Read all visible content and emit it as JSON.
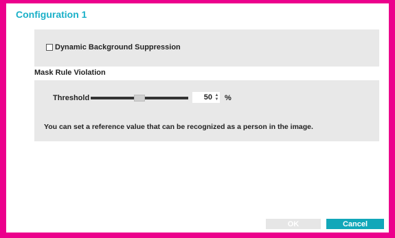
{
  "dialog": {
    "title": "Configuration 1",
    "accent_color": "#1ab0c8",
    "frame_color": "#ec008c"
  },
  "dynamic_background": {
    "label": "Dynamic Background Suppression",
    "checked": false
  },
  "mask_rule": {
    "section_label": "Mask Rule Violation",
    "threshold_label": "Threshold",
    "threshold_value": "50",
    "threshold_fraction": 0.5,
    "unit": "%",
    "description": "You can set a reference value that can be recognized as a person in the image."
  },
  "buttons": {
    "ok_label": "OK",
    "cancel_label": "Cancel",
    "cancel_color": "#12a7b9"
  }
}
